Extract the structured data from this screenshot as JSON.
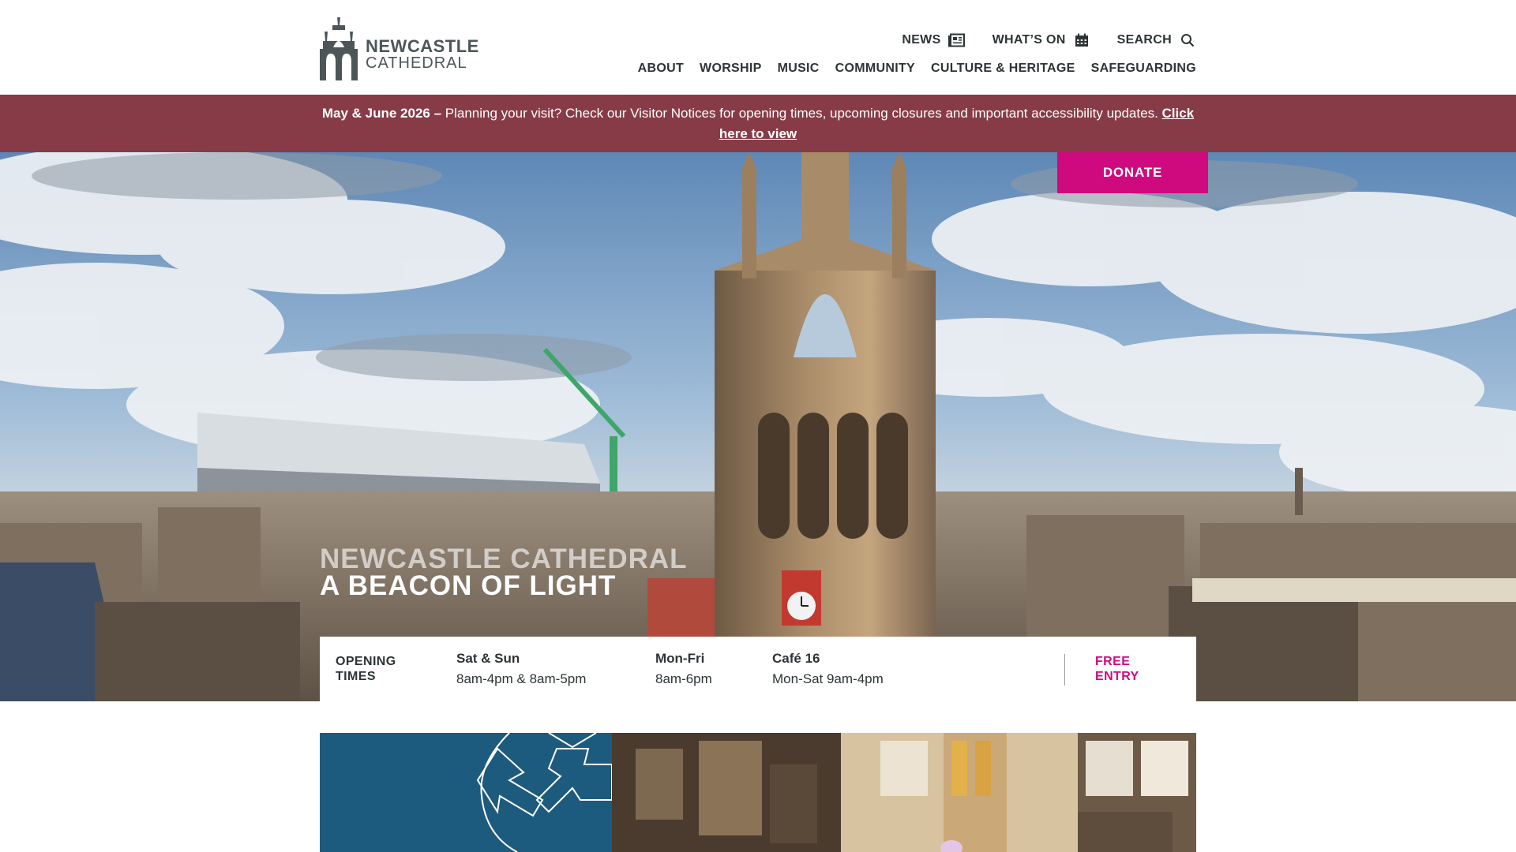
{
  "header": {
    "logo": {
      "line1": "NEWCASTLE",
      "line2": "CATHEDRAL"
    },
    "utility_nav": [
      {
        "label": "NEWS",
        "icon": "newspaper-icon"
      },
      {
        "label": "WHAT’S ON",
        "icon": "calendar-icon"
      },
      {
        "label": "SEARCH",
        "icon": "search-icon"
      }
    ],
    "main_nav": [
      "ABOUT",
      "WORSHIP",
      "MUSIC",
      "COMMUNITY",
      "CULTURE & HERITAGE",
      "SAFEGUARDING"
    ]
  },
  "notice": {
    "strong": "May & June 2026 –",
    "text": " Planning your visit? Check our Visitor Notices for opening times, upcoming closures and important accessibility updates. ",
    "link": "Click here to view"
  },
  "hero": {
    "donate_label": "DONATE",
    "title_line1": "NEWCASTLE CATHEDRAL",
    "title_line2": "A BEACON OF LIGHT"
  },
  "opening_times": {
    "label_line1": "OPENING",
    "label_line2": "TIMES",
    "entries": [
      {
        "day": "Sat & Sun",
        "hours": "8am-4pm & 8am-5pm"
      },
      {
        "day": "Mon-Fri",
        "hours": "8am-6pm"
      },
      {
        "day": "Café 16",
        "hours": "Mon-Sat 9am-4pm"
      }
    ],
    "free_line1": "FREE",
    "free_line2": "ENTRY"
  },
  "colors": {
    "notice_bg": "#873b47",
    "donate_bg": "#cf0a7f",
    "free_entry": "#cf0a7f",
    "feature_blue": "#1d5b7e",
    "text_dark": "#2d3436",
    "logo_grey": "#4c5659"
  }
}
